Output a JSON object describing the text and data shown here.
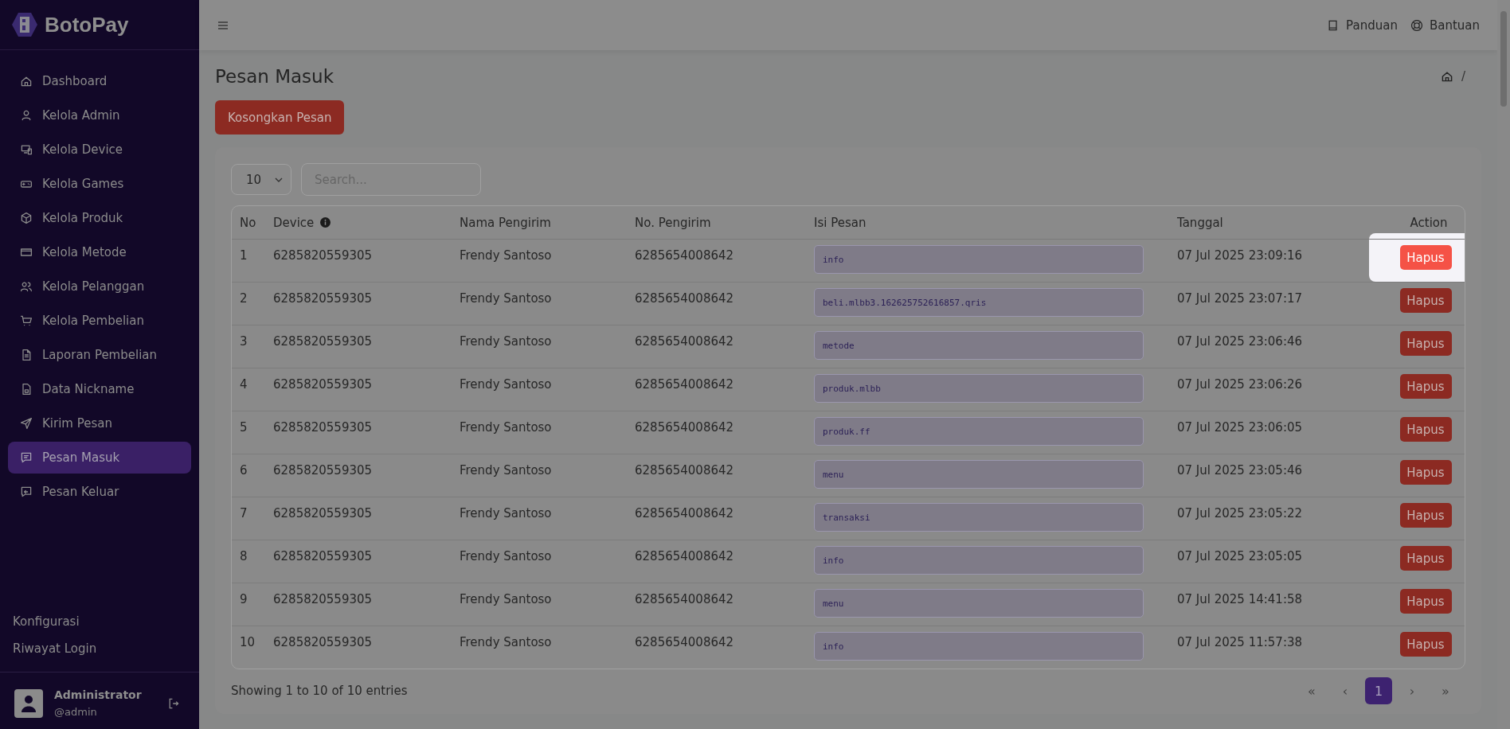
{
  "brand": "BotoPay",
  "sidebar": {
    "items": [
      {
        "label": "Dashboard",
        "selected": false
      },
      {
        "label": "Kelola Admin",
        "selected": false
      },
      {
        "label": "Kelola Device",
        "selected": false
      },
      {
        "label": "Kelola Games",
        "selected": false
      },
      {
        "label": "Kelola Produk",
        "selected": false
      },
      {
        "label": "Kelola Metode",
        "selected": false
      },
      {
        "label": "Kelola Pelanggan",
        "selected": false
      },
      {
        "label": "Kelola Pembelian",
        "selected": false
      },
      {
        "label": "Laporan Pembelian",
        "selected": false
      },
      {
        "label": "Data Nickname",
        "selected": false
      },
      {
        "label": "Kirim Pesan",
        "selected": false
      },
      {
        "label": "Pesan Masuk",
        "selected": true
      },
      {
        "label": "Pesan Keluar",
        "selected": false
      }
    ],
    "footer_links": [
      "Konfigurasi",
      "Riwayat Login"
    ],
    "user": {
      "name": "Administrator",
      "handle": "@admin"
    }
  },
  "topbar": {
    "links": [
      "Panduan",
      "Bantuan"
    ]
  },
  "page": {
    "title": "Pesan Masuk",
    "breadcrumb_separator": "/",
    "clear_button": "Kosongkan Pesan"
  },
  "table": {
    "page_size": "10",
    "search": {
      "placeholder": "Search..."
    },
    "columns": [
      "No",
      "Device",
      "Nama Pengirim",
      "No. Pengirim",
      "Isi Pesan",
      "Tanggal",
      "Action"
    ],
    "rows": [
      {
        "no": "1",
        "device": "6285820559305",
        "name": "Frendy Santoso",
        "sender": "6285654008642",
        "message": "info",
        "date": "07 Jul 2025 23:09:16",
        "action": "Hapus",
        "spotlight": true
      },
      {
        "no": "2",
        "device": "6285820559305",
        "name": "Frendy Santoso",
        "sender": "6285654008642",
        "message": "beli.mlbb3.162625752616857.qris",
        "date": "07 Jul 2025 23:07:17",
        "action": "Hapus",
        "spotlight": false
      },
      {
        "no": "3",
        "device": "6285820559305",
        "name": "Frendy Santoso",
        "sender": "6285654008642",
        "message": "metode",
        "date": "07 Jul 2025 23:06:46",
        "action": "Hapus",
        "spotlight": false
      },
      {
        "no": "4",
        "device": "6285820559305",
        "name": "Frendy Santoso",
        "sender": "6285654008642",
        "message": "produk.mlbb",
        "date": "07 Jul 2025 23:06:26",
        "action": "Hapus",
        "spotlight": false
      },
      {
        "no": "5",
        "device": "6285820559305",
        "name": "Frendy Santoso",
        "sender": "6285654008642",
        "message": "produk.ff",
        "date": "07 Jul 2025 23:06:05",
        "action": "Hapus",
        "spotlight": false
      },
      {
        "no": "6",
        "device": "6285820559305",
        "name": "Frendy Santoso",
        "sender": "6285654008642",
        "message": "menu",
        "date": "07 Jul 2025 23:05:46",
        "action": "Hapus",
        "spotlight": false
      },
      {
        "no": "7",
        "device": "6285820559305",
        "name": "Frendy Santoso",
        "sender": "6285654008642",
        "message": "transaksi",
        "date": "07 Jul 2025 23:05:22",
        "action": "Hapus",
        "spotlight": false
      },
      {
        "no": "8",
        "device": "6285820559305",
        "name": "Frendy Santoso",
        "sender": "6285654008642",
        "message": "info",
        "date": "07 Jul 2025 23:05:05",
        "action": "Hapus",
        "spotlight": false
      },
      {
        "no": "9",
        "device": "6285820559305",
        "name": "Frendy Santoso",
        "sender": "6285654008642",
        "message": "menu",
        "date": "07 Jul 2025 14:41:58",
        "action": "Hapus",
        "spotlight": false
      },
      {
        "no": "10",
        "device": "6285820559305",
        "name": "Frendy Santoso",
        "sender": "6285654008642",
        "message": "info",
        "date": "07 Jul 2025 11:57:38",
        "action": "Hapus",
        "spotlight": false
      }
    ],
    "summary": "Showing 1 to 10 of 10 entries",
    "pagination": [
      {
        "label": "«",
        "selected": false
      },
      {
        "label": "‹",
        "selected": false
      },
      {
        "label": "1",
        "selected": true
      },
      {
        "label": "›",
        "selected": false
      },
      {
        "label": "»",
        "selected": false
      }
    ]
  }
}
